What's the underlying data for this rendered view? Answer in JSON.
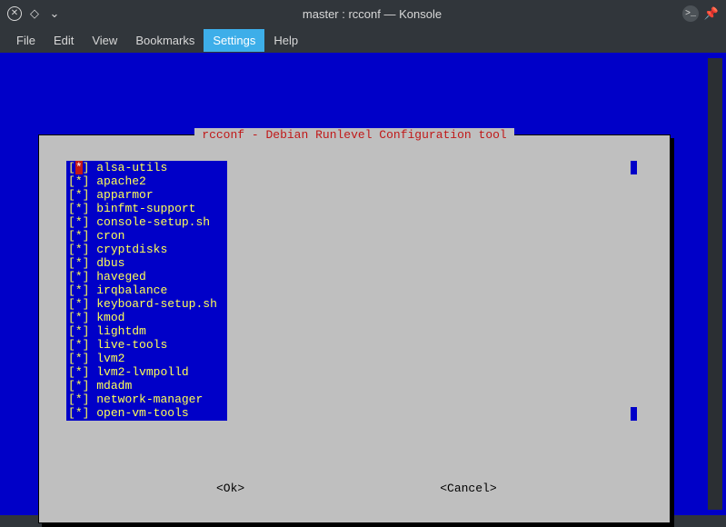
{
  "window": {
    "title": "master : rcconf — Konsole"
  },
  "menubar": {
    "items": [
      "File",
      "Edit",
      "View",
      "Bookmarks",
      "Settings",
      "Help"
    ],
    "active_index": 4
  },
  "dialog": {
    "title": "rcconf - Debian Runlevel Configuration tool",
    "ok_label": "<Ok>",
    "cancel_label": "<Cancel>",
    "services": [
      {
        "checked": true,
        "name": "alsa-utils",
        "selected": true
      },
      {
        "checked": true,
        "name": "apache2"
      },
      {
        "checked": true,
        "name": "apparmor"
      },
      {
        "checked": true,
        "name": "binfmt-support"
      },
      {
        "checked": true,
        "name": "console-setup.sh"
      },
      {
        "checked": true,
        "name": "cron"
      },
      {
        "checked": true,
        "name": "cryptdisks"
      },
      {
        "checked": true,
        "name": "dbus"
      },
      {
        "checked": true,
        "name": "haveged"
      },
      {
        "checked": true,
        "name": "irqbalance"
      },
      {
        "checked": true,
        "name": "keyboard-setup.sh"
      },
      {
        "checked": true,
        "name": "kmod"
      },
      {
        "checked": true,
        "name": "lightdm"
      },
      {
        "checked": true,
        "name": "live-tools"
      },
      {
        "checked": true,
        "name": "lvm2"
      },
      {
        "checked": true,
        "name": "lvm2-lvmpolld"
      },
      {
        "checked": true,
        "name": "mdadm"
      },
      {
        "checked": true,
        "name": "network-manager"
      },
      {
        "checked": true,
        "name": "open-vm-tools"
      }
    ]
  }
}
